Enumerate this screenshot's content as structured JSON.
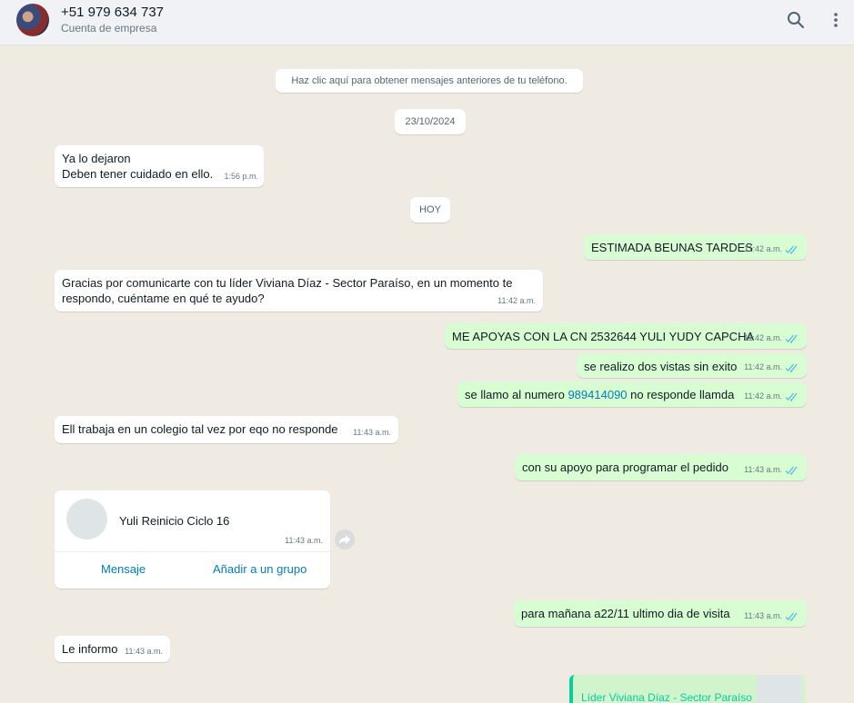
{
  "header": {
    "title": "+51 979 634 737",
    "subtitle": "Cuenta de empresa",
    "search_icon": "search-icon",
    "menu_icon": "kebab-menu-icon"
  },
  "system": {
    "older_messages": "Haz clic aquí para obtener mensajes anteriores de tu teléfono.",
    "date1": "23/10/2024",
    "date2": "HOY"
  },
  "messages": [
    {
      "dir": "in",
      "lines": [
        "Ya lo dejaron",
        "Deben tener cuidado en ello."
      ],
      "time": "1:56 p.m."
    },
    {
      "dir": "out",
      "text": "ESTIMADA BEUNAS TARDES",
      "time": "11:42 a.m."
    },
    {
      "dir": "in",
      "lines": [
        "Gracias por comunicarte con tu líder Viviana Díaz - Sector Paraíso, en un momento te",
        "respondo, cuéntame en qué te ayudo?"
      ],
      "time": "11:42 a.m."
    },
    {
      "dir": "out",
      "text": "ME APOYAS CON LA CN  2532644 YULI YUDY CAPCHA",
      "time": "11:42 a.m."
    },
    {
      "dir": "out",
      "text": "se realizo dos vistas sin exito",
      "time": "11:42 a.m."
    },
    {
      "dir": "out",
      "text_before": "se llamo al numero ",
      "link": "989414090",
      "text_after": " no responde llamda",
      "time": "11:42 a.m."
    },
    {
      "dir": "in",
      "text": "Ell trabaja en un colegio tal vez por eqo no responde",
      "time": "11:43 a.m."
    },
    {
      "dir": "out",
      "text": "con su apoyo para programar el pedido",
      "time": "11:43 a.m."
    },
    {
      "dir": "out",
      "text": "para mañana  a22/11 ultimo dia de visita",
      "time": "11:43 a.m."
    },
    {
      "dir": "in",
      "text": "Le informo",
      "time": "11:43 a.m."
    }
  ],
  "contact_card": {
    "name": "Yuli Reinicio Ciclo 16",
    "time": "11:43 a.m.",
    "message_label": "Mensaje",
    "add_group_label": "Añadir a un grupo"
  },
  "quoted_preview": {
    "name": "Líder Viviana Díaz - Sector Paraíso"
  },
  "colors": {
    "incoming": "#ffffff",
    "outgoing": "#d9fdd3",
    "read_ticks": "#53bdeb",
    "link": "#027eb5"
  }
}
